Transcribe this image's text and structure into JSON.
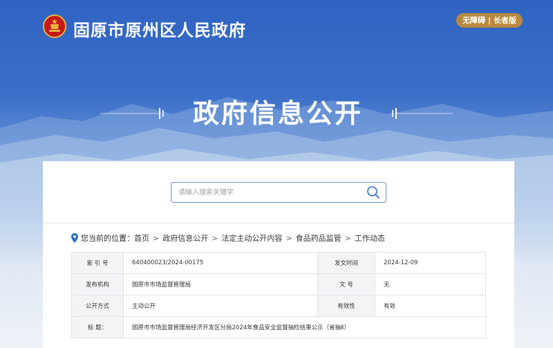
{
  "header": {
    "site_title": "固原市原州区人民政府",
    "a11y_mode": "无障碍",
    "elder_mode": "长者版",
    "separator": "|"
  },
  "hero": {
    "title": "政府信息公开"
  },
  "search": {
    "placeholder": "请输入搜索关键字"
  },
  "breadcrumb": {
    "prefix": "您当前的位置：",
    "items": [
      "首页",
      "政府信息公开",
      "法定主动公开内容",
      "食品药品监管",
      "工作动态"
    ],
    "separator": ">"
  },
  "meta": {
    "index_no_label": "索 引 号",
    "index_no": "640400023/2024-00175",
    "publish_date_label": "发文时间",
    "publish_date": "2024-12-09",
    "issuer_label": "发布机构",
    "issuer": "固原市市场监督管理局",
    "doc_no_label": "文    号",
    "doc_no": "无",
    "disclosure_label": "公开方式",
    "disclosure": "主动公开",
    "validity_label": "有效性",
    "validity": "有效",
    "title_label": "标    题：",
    "title": "固原市市场监督管理局经济开发区分局2024年食品安全监督抽检结果公示（省抽Ⅱ）"
  },
  "colors": {
    "banner_top": "#2f63c2",
    "badge": "#b8893e",
    "accent": "#2b6cc4"
  }
}
